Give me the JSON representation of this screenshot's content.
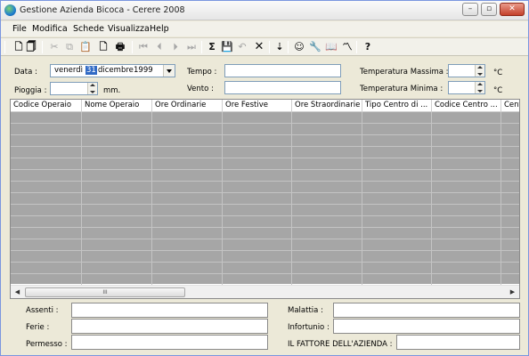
{
  "window": {
    "title": "Gestione Azienda Bicoca - Cerere 2008",
    "minimize_icon": "minimize-icon",
    "maximize_icon": "maximize-icon",
    "close_icon": "close-icon"
  },
  "menu": [
    "File",
    "Modifica",
    "Schede",
    "Visualizza",
    "Help"
  ],
  "toolbar": {
    "icons": [
      "new-icon",
      "copy-doc-icon",
      "cut-icon",
      "copy-icon",
      "paste-icon",
      "document-icon",
      "print-icon",
      "first-record-icon",
      "previous-record-icon",
      "next-record-icon",
      "last-record-icon",
      "sum-icon",
      "save-icon",
      "undo-icon",
      "delete-icon",
      "sort-icon",
      "worker-icon",
      "tools-icon",
      "book-icon",
      "chart-icon",
      "help-icon"
    ]
  },
  "form": {
    "data_label": "Data :",
    "date": {
      "weekday": "venerdì",
      "day": "31",
      "month": "dicembre",
      "year": "1999"
    },
    "pioggia_label": "Pioggia :",
    "pioggia_unit": "mm.",
    "tempo_label": "Tempo :",
    "vento_label": "Vento :",
    "temp_max_label": "Temperatura Massima :",
    "temp_min_label": "Temperatura Minima :",
    "temp_unit": "°C",
    "pioggia_value": "",
    "tempo_value": "",
    "vento_value": "",
    "temp_max_value": "",
    "temp_min_value": ""
  },
  "grid": {
    "columns": [
      "Codice Operaio",
      "Nome Operaio",
      "Ore Ordinarie",
      "Ore Festive",
      "Ore Straordinarie",
      "Tipo Centro di ...",
      "Codice Centro ...",
      "Cent"
    ],
    "row_count": 15,
    "scroll_thumb_grip": "III"
  },
  "bottom": {
    "assenti_label": "Assenti :",
    "ferie_label": "Ferie :",
    "permesso_label": "Permesso :",
    "malattia_label": "Malattia :",
    "infortunio_label": "Infortunio :",
    "fattore_label": "IL FATTORE DELL'AZIENDA :",
    "assenti_value": "",
    "ferie_value": "",
    "permesso_value": "",
    "malattia_value": "",
    "infortunio_value": "",
    "fattore_value": ""
  }
}
